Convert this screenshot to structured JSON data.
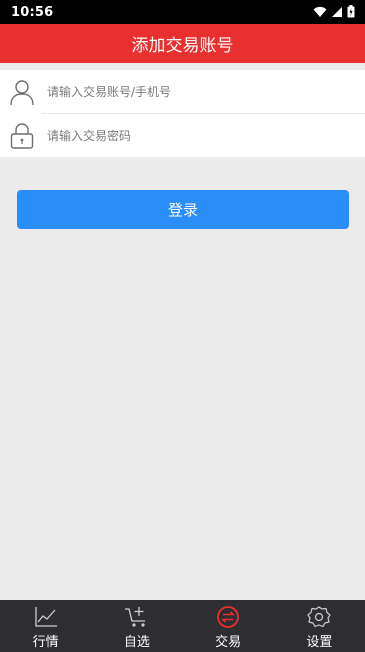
{
  "status_bar": {
    "time": "10:56"
  },
  "header": {
    "title": "添加交易账号"
  },
  "form": {
    "account_placeholder": "请输入交易账号/手机号",
    "password_placeholder": "请输入交易密码"
  },
  "login_label": "登录",
  "tabs": [
    {
      "label": "行情",
      "icon": "chart-icon"
    },
    {
      "label": "自选",
      "icon": "cart-add-icon"
    },
    {
      "label": "交易",
      "icon": "exchange-icon",
      "active": true
    },
    {
      "label": "设置",
      "icon": "gear-icon"
    }
  ],
  "colors": {
    "header": "#e8302f",
    "button": "#2a8ef9",
    "tabbar": "#2e2e32",
    "active_icon": "#e8302f"
  }
}
